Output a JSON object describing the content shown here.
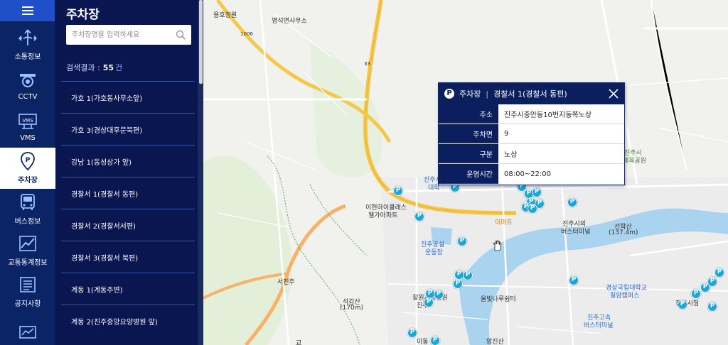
{
  "sidebar": {
    "items": [
      {
        "label": "소통정보",
        "icon": "traffic-arrows-icon"
      },
      {
        "label": "CCTV",
        "icon": "cctv-icon"
      },
      {
        "label": "VMS",
        "icon": "vms-sign-icon",
        "badge": "VMS"
      },
      {
        "label": "주차장",
        "icon": "parking-icon",
        "active": true
      },
      {
        "label": "버스정보",
        "icon": "bus-icon"
      },
      {
        "label": "교통통계정보",
        "icon": "statistics-icon"
      },
      {
        "label": "공지사항",
        "icon": "notice-icon"
      },
      {
        "label": "",
        "icon": "monitor-icon"
      }
    ]
  },
  "panel": {
    "title": "주차장",
    "search_placeholder": "주차장명을 입력하세요",
    "result_label": "검색결과 :",
    "result_count": "55",
    "result_unit": "건",
    "list": [
      "가호 1(가호동사무소앞)",
      "가호 3(경상대후문북편)",
      "강남 1(동성상가 앞)",
      "경찰서 1(경찰서 동편)",
      "경찰서 2(경찰서서편)",
      "경찰서 3(경찰서 북편)",
      "계동 1(계동주변)",
      "계동 2(진주중앙요양병원 앞)"
    ]
  },
  "popup": {
    "category": "주차장",
    "separator": "|",
    "name": "경찰서 1(경찰서 동편)",
    "rows": [
      {
        "key": "주소",
        "value": "진주시중안동10번지동쪽노상"
      },
      {
        "key": "주차면",
        "value": "9"
      },
      {
        "key": "구분",
        "value": "노상"
      },
      {
        "key": "운영시간",
        "value": "08:00~22:00"
      }
    ]
  },
  "map": {
    "labels": [
      "용호정원",
      "명석면사무소",
      "1006",
      "33",
      "진주시",
      "이현하이클래스",
      "웰가아파트",
      "진주공설",
      "운동장",
      "이마트",
      "진주시외",
      "버스터미널",
      "선학산",
      "(137.4m)",
      "진주시",
      "체육공원",
      "서진주",
      "석갑산",
      "(170m)",
      "창원지방법원",
      "진주",
      "울빛나루쉼터",
      "경상국립대학교",
      "칠암캠퍼스",
      "진주고속",
      "버스터미널",
      "진주시청",
      "대학",
      "망진산",
      "이동",
      "교"
    ],
    "colors": {
      "water": "#a9d3ee",
      "highway": "#f6c84a",
      "road": "#ffffff",
      "park": "#d7ecc9",
      "pin": "#19a7d8"
    }
  }
}
